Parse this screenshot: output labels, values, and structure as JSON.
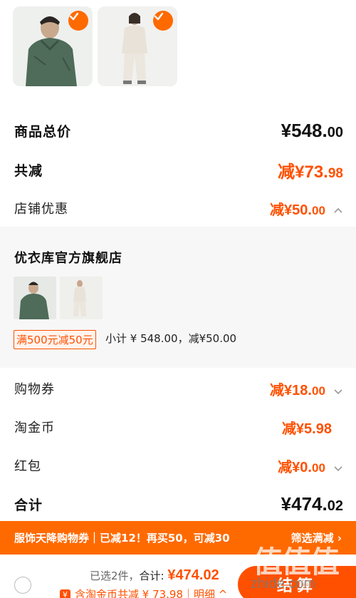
{
  "products": [
    {
      "name": "green-jacket",
      "checked": true
    },
    {
      "name": "white-outfit",
      "checked": true
    }
  ],
  "summary": {
    "total_label": "商品总价",
    "total_main": "¥548.",
    "total_dec": "00",
    "reduce_label": "共减",
    "reduce_main": "减¥73.",
    "reduce_dec": "98",
    "shop_discount_label": "店铺优惠",
    "shop_discount_main": "减¥50.",
    "shop_discount_dec": "00"
  },
  "shop": {
    "name": "优衣库官方旗舰店",
    "promo_tag": "满500元减50元",
    "subtotal": "小计 ¥ 548.00，减¥50.00"
  },
  "discounts": {
    "coupon_label": "购物券",
    "coupon_main": "减¥18.",
    "coupon_dec": "00",
    "coin_label": "淘金币",
    "coin_value": "减¥5.98",
    "redpack_label": "红包",
    "redpack_main": "减¥0.",
    "redpack_dec": "00",
    "grand_label": "合计",
    "grand_main": "¥474.",
    "grand_dec": "02"
  },
  "banner": {
    "text": "服饰天降购物券｜已减12！再买50，可减30",
    "filter": "筛选满减 ›"
  },
  "bottom": {
    "selected": "已选2件，",
    "total_label": "合计:",
    "total_value": "¥474.02",
    "coin_icon": "¥",
    "coin_text": "含淘金币共减 ¥ 73.98",
    "detail": "｜明细 ^",
    "checkout": "结算"
  },
  "watermark": {
    "logo": "值值值",
    "url": "zhide.com"
  },
  "colors": {
    "accent": "#ff5000",
    "banner": "#ff6a00"
  }
}
